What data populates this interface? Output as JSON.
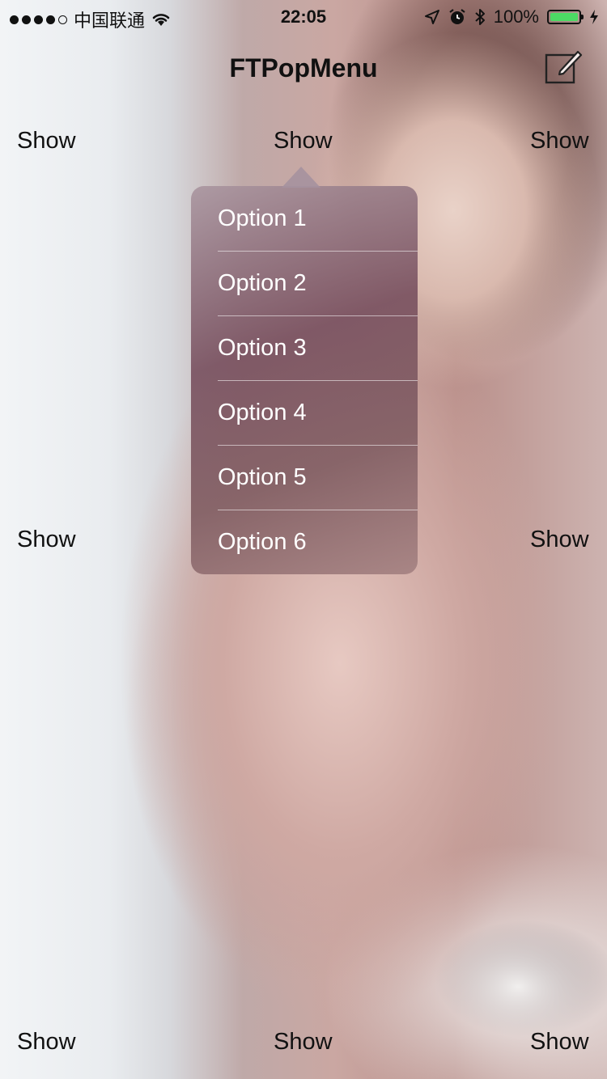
{
  "status_bar": {
    "carrier": "中国联通",
    "time": "22:05",
    "battery_percent": "100%",
    "battery_level": 1.0,
    "signal_bars": 4,
    "icons": [
      "wifi-icon",
      "location-icon",
      "alarm-icon",
      "bluetooth-icon",
      "charging-icon"
    ]
  },
  "nav": {
    "title": "FTPopMenu",
    "right_icon": "compose-icon"
  },
  "buttons": {
    "top_left": "Show",
    "top_center": "Show",
    "top_right": "Show",
    "middle_left": "Show",
    "middle_right": "Show",
    "bottom_left": "Show",
    "bottom_center": "Show",
    "bottom_right": "Show"
  },
  "menu": {
    "items": [
      {
        "label": "Option 1"
      },
      {
        "label": "Option 2"
      },
      {
        "label": "Option 3"
      },
      {
        "label": "Option 4"
      },
      {
        "label": "Option 5"
      },
      {
        "label": "Option 6"
      }
    ]
  },
  "colors": {
    "battery_fill": "#4cd964",
    "text": "#111111",
    "menu_text": "#ffffff"
  }
}
